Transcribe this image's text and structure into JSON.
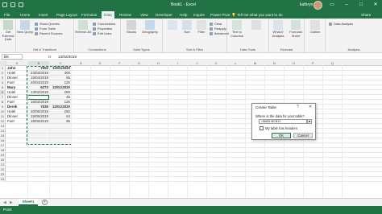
{
  "window": {
    "title": "Book1 - Excel",
    "user": "kathryn"
  },
  "tabs": [
    {
      "label": "File"
    },
    {
      "label": "Home"
    },
    {
      "label": "Insert"
    },
    {
      "label": "Page Layout"
    },
    {
      "label": "Formulas"
    },
    {
      "label": "Data",
      "active": true
    },
    {
      "label": "Review"
    },
    {
      "label": "View"
    },
    {
      "label": "Developer"
    },
    {
      "label": "Help"
    },
    {
      "label": "Inquire"
    },
    {
      "label": "Power Pivot"
    }
  ],
  "tell_me": "Tell me what you want to do",
  "share": "Share",
  "ribbon": {
    "get_external_data": "Get External Data",
    "new_query": "New Query",
    "show_queries": "Show Queries",
    "from_table": "From Table",
    "recent_sources": "Recent Sources",
    "refresh_all": "Refresh All",
    "connections": "Connections",
    "properties": "Properties",
    "edit_links": "Edit Links",
    "stocks": "Stocks",
    "geography": "Geography",
    "sort": "Sort",
    "filter": "Filter",
    "clear": "Clear",
    "reapply": "Reapply",
    "advanced": "Advanced",
    "text_to_columns": "Text to Columns",
    "what_if": "What-If Analysis",
    "forecast_sheet": "Forecast Sheet",
    "outline": "Outline",
    "data_analysis": "Data Analysis",
    "groups": {
      "get_transform": "Get & Transform",
      "connections": "Connections",
      "data_types": "Data Types",
      "sort_filter": "Sort & Filter",
      "data_tools": "Data Tools",
      "forecast": "Forecast",
      "analysis": "Analysis"
    }
  },
  "formula_bar": {
    "name_box": "B6",
    "fx": "fx",
    "value": "13/02/2019"
  },
  "columns": [
    "A",
    "B",
    "C",
    "D",
    "E",
    "F",
    "G",
    "H",
    "I",
    "J",
    "K",
    "L",
    "M",
    "N",
    "O",
    "P",
    "Q"
  ],
  "rows": [
    {
      "num": "1",
      "a": "John",
      "b": "7652",
      "c": "12/01/2020",
      "bold": true
    },
    {
      "num": "2",
      "a": "Hotel",
      "b": "23/03/2019",
      "c": "300"
    },
    {
      "num": "3",
      "a": "Dinner",
      "b": "15/04/2019",
      "c": "65"
    },
    {
      "num": "4",
      "a": "Fuel",
      "b": "20/04/2019",
      "c": "120"
    },
    {
      "num": "5",
      "a": "Mary",
      "b": "6273",
      "c": "12/01/2020",
      "bold": true
    },
    {
      "num": "6",
      "a": "Hotel",
      "b": "13/02/2019",
      "c": "250"
    },
    {
      "num": "7",
      "a": "Dinner",
      "b": "15/02/2019",
      "c": "45"
    },
    {
      "num": "8",
      "a": "Fuel",
      "b": "16/02/2019",
      "c": "120"
    },
    {
      "num": "9",
      "a": "Derek",
      "b": "7635",
      "c": "12/01/2020",
      "bold": true
    },
    {
      "num": "10",
      "a": "Hotel",
      "b": "20/05/2019",
      "c": "250"
    },
    {
      "num": "11",
      "a": "Dinner",
      "b": "15/05/2019",
      "c": "64"
    },
    {
      "num": "12",
      "a": "Fuel",
      "b": "18/05/2019",
      "c": "95"
    },
    {
      "num": "13",
      "a": "",
      "b": "",
      "c": ""
    },
    {
      "num": "14",
      "a": "",
      "b": "",
      "c": ""
    },
    {
      "num": "15",
      "a": "",
      "b": "",
      "c": ""
    },
    {
      "num": "16",
      "a": "",
      "b": "",
      "c": ""
    },
    {
      "num": "17",
      "a": "",
      "b": "",
      "c": ""
    },
    {
      "num": "18",
      "a": "",
      "b": "",
      "c": ""
    },
    {
      "num": "19",
      "a": "",
      "b": "",
      "c": ""
    },
    {
      "num": "20",
      "a": "",
      "b": "",
      "c": ""
    },
    {
      "num": "21",
      "a": "",
      "b": "",
      "c": ""
    },
    {
      "num": "22",
      "a": "",
      "b": "",
      "c": ""
    },
    {
      "num": "23",
      "a": "",
      "b": "",
      "c": ""
    },
    {
      "num": "24",
      "a": "",
      "b": "",
      "c": ""
    }
  ],
  "sheet_tab": "Sheet1",
  "status": "Point",
  "dialog": {
    "title": "Create Table",
    "help": "?",
    "close": "✕",
    "question": "Where is the data for your table?",
    "range": "=$A$1:$C$12",
    "has_headers": "My table has headers",
    "ok": "OK",
    "cancel": "Cancel"
  },
  "colors": {
    "brand": "#217346",
    "ribbon_bg": "#f3f3f3"
  }
}
